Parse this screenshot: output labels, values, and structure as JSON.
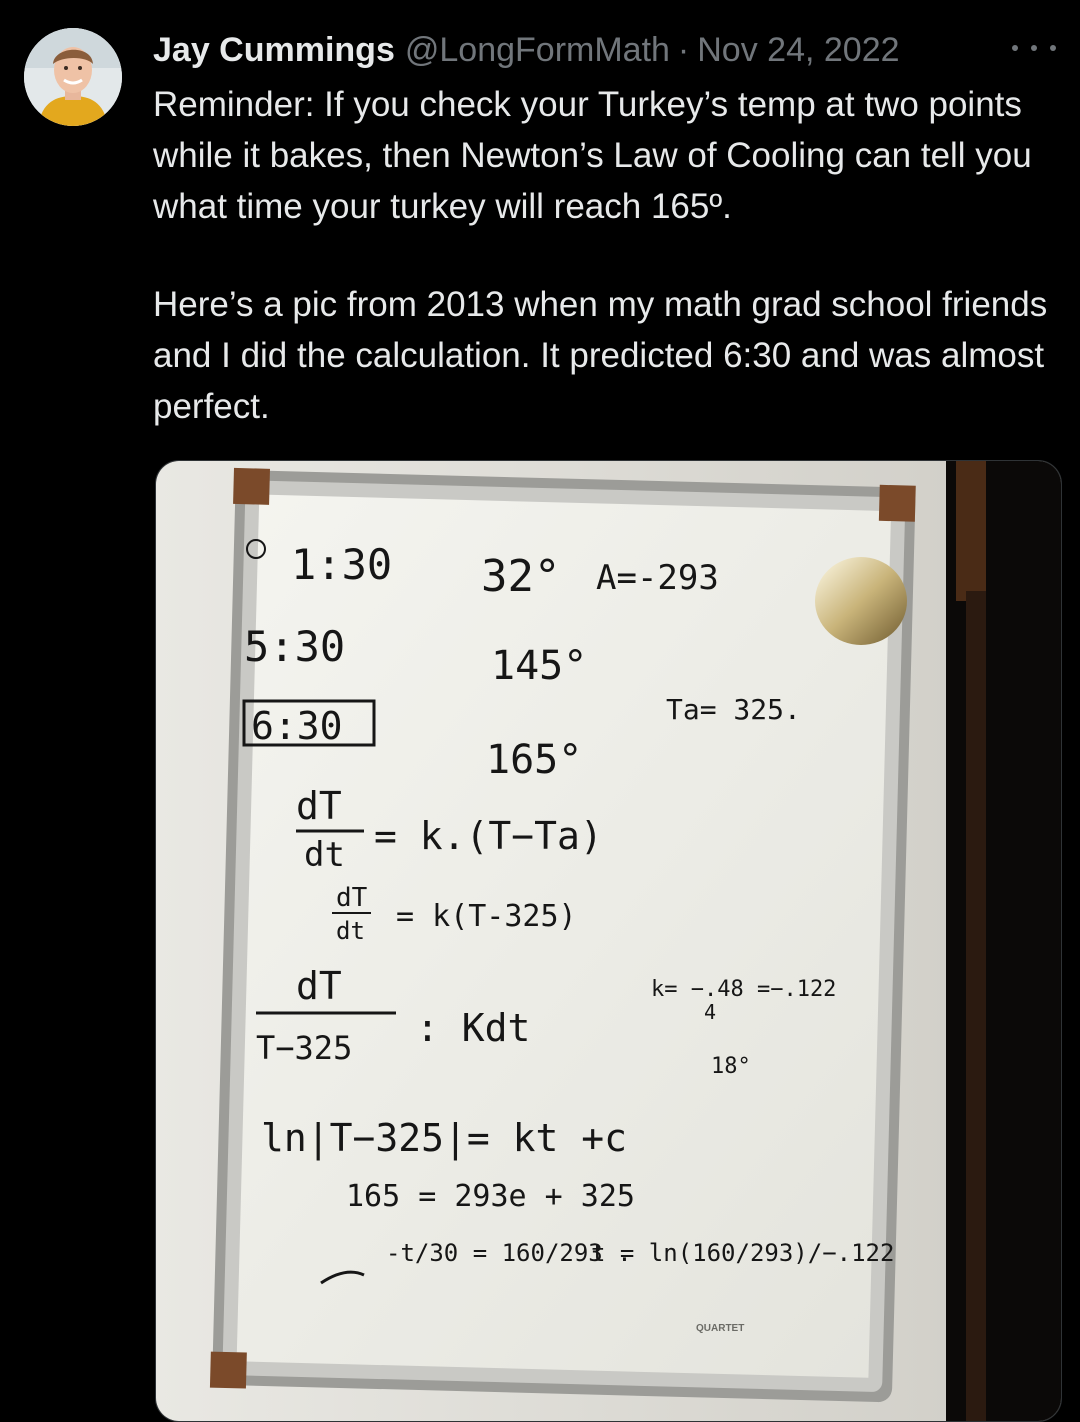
{
  "author": {
    "name": "Jay Cummings",
    "handle": "@LongFormMath",
    "separator": "·",
    "date": "Nov 24, 2022"
  },
  "tweet": {
    "paragraph_1": "Reminder: If you check your Turkey’s temp at two points while it bakes, then Newton’s Law of Cooling can tell you what time your turkey will reach 165º.",
    "paragraph_2": "Here’s a pic from 2013 when my math grad school friends and I did the calculation. It predicted 6:30 and was almost perfect."
  },
  "whiteboard": {
    "line_1_time": "1:30",
    "line_1_temp": "32°",
    "line_1_a": "A=-293",
    "line_2_time": "5:30",
    "line_2_temp": "145°",
    "line_3_time": "6:30",
    "line_3_temp": "165°",
    "ambient": "Ta= 325.",
    "eq_1_lhs_top": "dT",
    "eq_1_lhs_bottom": "dt",
    "eq_1_rhs": "= k.(T−Ta)",
    "eq_2_lhs_top": "dT",
    "eq_2_lhs_bottom": "dt",
    "eq_2_rhs": "= k(T-325)",
    "eq_3_top": "dT",
    "eq_3_bottom": "T−325",
    "eq_3_rhs": ": Kdt",
    "k_value": "k= −.48 =−.122",
    "k_denominator": "4",
    "note_180": "18°",
    "ln_line": "ln|T−325|= kt +c",
    "solve_line": "165 = 293e  + 325",
    "ratio_line": "-t/30 = 160/293 .",
    "t_line": "t = ln(160/293)/−.122",
    "brand": "QUARTET"
  },
  "colors": {
    "background": "#000000",
    "text": "#e7e9ea",
    "secondary_text": "#71767b",
    "whiteboard": "#f1f1ec",
    "marker": "#161616"
  }
}
